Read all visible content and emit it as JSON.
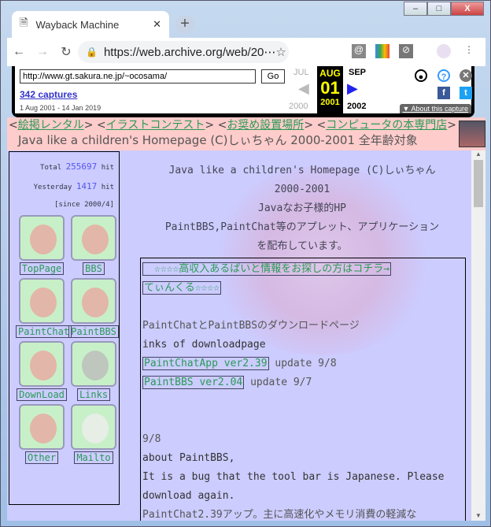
{
  "browser": {
    "tab_title": "Wayback Machine",
    "url": "https://web.archive.org/web/20⋯"
  },
  "wayback": {
    "url_value": "http://www.gt.sakura.ne.jp/~ocosama/",
    "go_label": "Go",
    "captures": "342 captures",
    "range": "1 Aug 2001 - 14 Jan 2019",
    "prev_month": "JUL",
    "cur_month": "AUG",
    "next_month": "SEP",
    "day": "01",
    "prev_year": "2000",
    "cur_year": "2001",
    "next_year": "2002",
    "about": "About this capture"
  },
  "nav": {
    "links": [
      "絵掲レンタル",
      "イラストコンテスト",
      "お奨め設置場所",
      "コンピュータの本専門店"
    ],
    "page_title": "Java like a children's Homepage (C)しぃちゃん 2000-2001 全年齢対象"
  },
  "sidebar": {
    "total_label": "Total",
    "total": "255697",
    "yesterday_label": "Yesterday",
    "yesterday": "1417",
    "hit": "hit",
    "since": "[since 2000/4]",
    "items": [
      "TopPage",
      "BBS",
      "PaintChat",
      "PaintBBS",
      "DownLoad",
      "Links",
      "Other",
      "Mailto"
    ]
  },
  "main": {
    "lines": [
      "Java like a children's Homepage (C)しぃちゃん",
      "2000-2001",
      "Javaなお子様的HP",
      "PaintBBS,PaintChat等のアプレット、アプリケーション",
      "を配布しています。"
    ],
    "ad1": "　☆☆☆☆高収入あるばいと情報をお探しの方はコチラ→",
    "ad2": "てぃんくる☆☆☆☆",
    "dl_title": "PaintChatとPaintBBSのダウンロードページ",
    "dl_sub": "inks of downloadpage",
    "link1": "PaintChatApp ver2.39",
    "upd1": "update 9/8",
    "link2": "PaintBBS ver2.04",
    "upd2": "update 9/7",
    "date": "9/8",
    "news1": "about PaintBBS,",
    "news2": "It is a bug that the tool bar is Japanese. Please",
    "news3": "download again.",
    "news4": "PaintChat2.39アップ。主に高速化やメモリ消費の軽減な"
  }
}
